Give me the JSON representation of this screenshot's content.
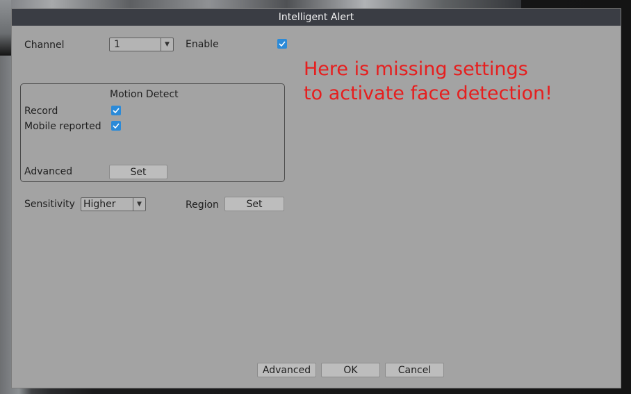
{
  "window": {
    "title": "Intelligent Alert"
  },
  "form": {
    "channel_label": "Channel",
    "channel_value": "1",
    "enable_label": "Enable",
    "enable_checked": true,
    "motion_group": {
      "title": "Motion Detect",
      "record_label": "Record",
      "record_checked": true,
      "mobile_label": "Mobile reported",
      "mobile_checked": true,
      "advanced_label": "Advanced",
      "set_button": "Set"
    },
    "sensitivity_label": "Sensitivity",
    "sensitivity_value": "Higher",
    "region_label": "Region",
    "region_set_button": "Set"
  },
  "footer": {
    "advanced_button": "Advanced",
    "ok_button": "OK",
    "cancel_button": "Cancel"
  },
  "annotation": {
    "line1": "Here is missing settings",
    "line2": "to activate face detection!",
    "color": "#e61e1e"
  },
  "colors": {
    "dialog_bg": "#a3a3a3",
    "titlebar_bg": "#3a3d44",
    "checkbox_accent": "#2b8ad8"
  },
  "icons": [
    "checkmark-icon",
    "dropdown-arrow-icon"
  ]
}
